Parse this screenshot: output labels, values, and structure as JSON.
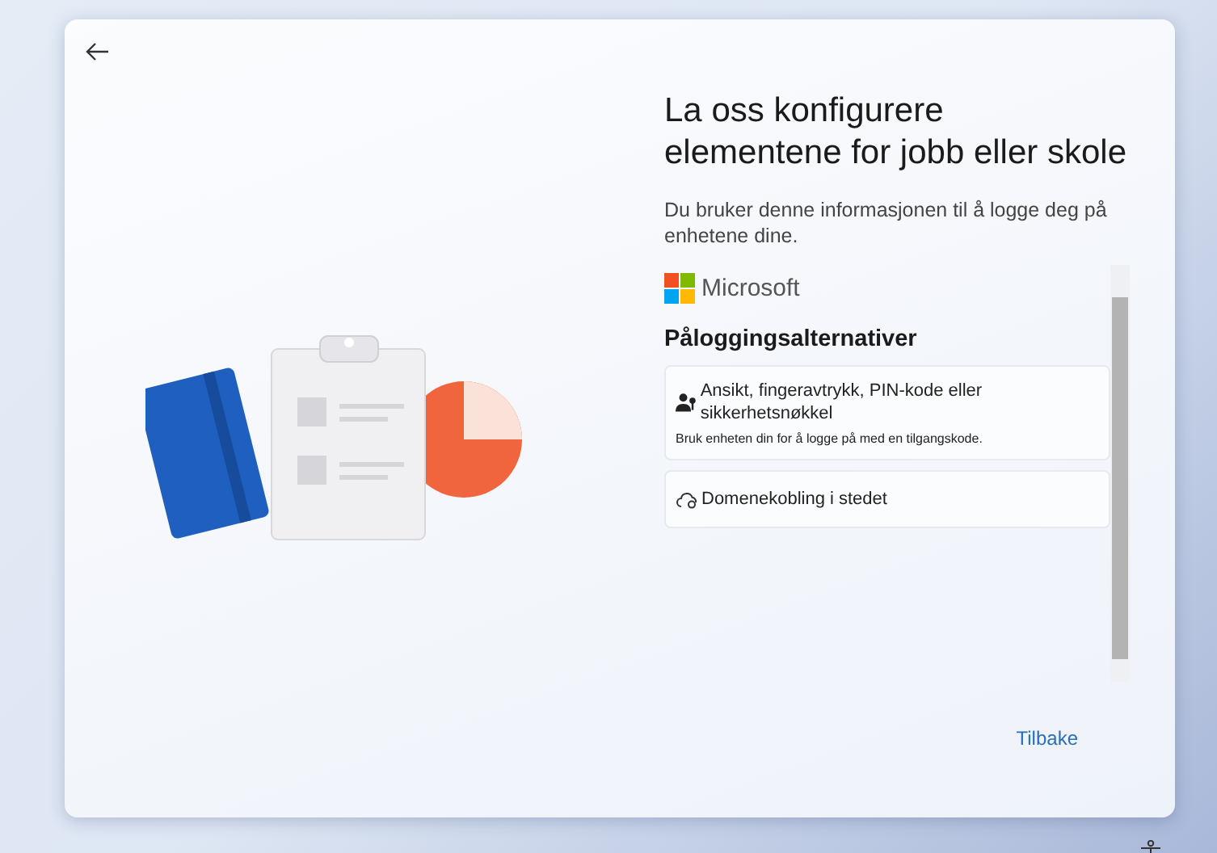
{
  "title": "La oss konfigurere elementene for jobb eller skole",
  "subtitle": "Du bruker denne informasjonen til å logge deg på enhetene dine.",
  "brand": "Microsoft",
  "section_heading": "Påloggingsalternativer",
  "options": [
    {
      "kind": "key",
      "title": "Ansikt, fingeravtrykk, PIN-kode eller sikkerhetsnøkkel",
      "description": "Bruk enheten din for å logge på med en tilgangskode."
    },
    {
      "kind": "domain",
      "title": "Domenekobling i stedet"
    }
  ],
  "back_button": "Tilbake"
}
